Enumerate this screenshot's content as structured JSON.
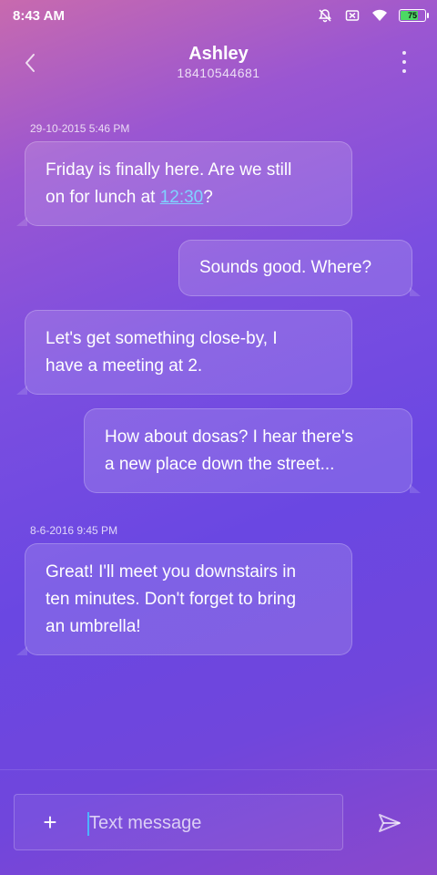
{
  "status_bar": {
    "time": "8:43 AM",
    "battery_level": "75",
    "icons": [
      "notifications-off-icon",
      "sim-off-icon",
      "wifi-icon",
      "battery-icon"
    ]
  },
  "header": {
    "contact_name": "Ashley",
    "contact_number": "18410544681",
    "back_icon": "chevron-left-icon",
    "menu_icon": "more-vertical-icon"
  },
  "conversation": {
    "timestamps": [
      "29-10-2015 5:46 PM",
      "8-6-2016 9:45 PM"
    ],
    "messages": [
      {
        "direction": "incoming",
        "line1": "Friday is finally here. Are we still",
        "line2_prefix": "on for lunch at ",
        "line2_link": "12:30",
        "line2_suffix": "?"
      },
      {
        "direction": "outgoing",
        "line1": "Sounds good. Where?"
      },
      {
        "direction": "incoming",
        "line1": "Let's get something close-by, I",
        "line2": "have a meeting at 2."
      },
      {
        "direction": "outgoing",
        "line1": "How about dosas? I hear there's",
        "line2": "a new place down the street..."
      },
      {
        "direction": "incoming",
        "line1": "Great! I'll meet you downstairs in",
        "line2": "ten minutes. Don't forget to bring",
        "line3": "an umbrella!"
      }
    ]
  },
  "compose": {
    "attach_label": "+",
    "placeholder": "Text message",
    "value": "",
    "send_icon": "send-icon"
  },
  "colors": {
    "link": "#7fd3ff",
    "battery": "#4cd964",
    "caret": "#4db3ff"
  }
}
